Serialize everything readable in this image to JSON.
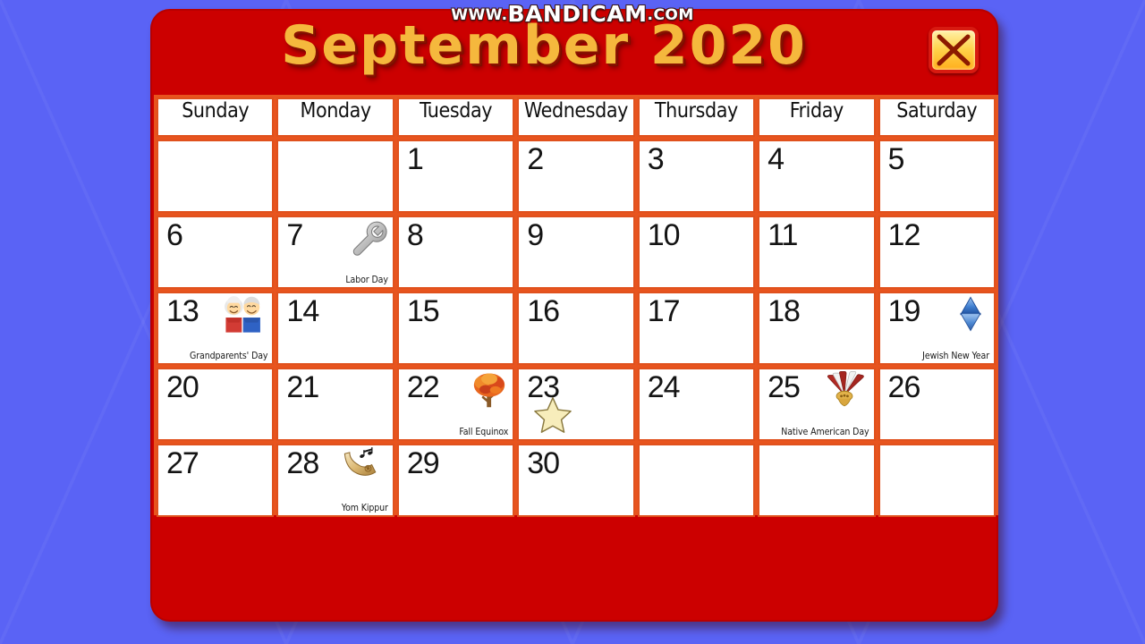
{
  "watermark": {
    "prefix": "WWW.",
    "brand": "BANDICAM",
    "suffix": ".COM"
  },
  "window": {
    "title": "September 2020",
    "close_label": "×",
    "close_icon": "close-x-icon",
    "panel_color": "#cc0000",
    "title_color": "#f5b83d",
    "grid_line_color": "#e8541e",
    "blank_cell_color": "#ff9300",
    "background_color": "#5a63f5"
  },
  "calendar": {
    "month": "September",
    "year": "2020",
    "weekdays": [
      "Sunday",
      "Monday",
      "Tuesday",
      "Wednesday",
      "Thursday",
      "Friday",
      "Saturday"
    ],
    "weeks": [
      [
        {
          "day": "",
          "blank": true
        },
        {
          "day": "",
          "blank": true
        },
        {
          "day": "1"
        },
        {
          "day": "2"
        },
        {
          "day": "3"
        },
        {
          "day": "4"
        },
        {
          "day": "5"
        }
      ],
      [
        {
          "day": "6"
        },
        {
          "day": "7",
          "holiday": "Labor Day",
          "icon": "wrench-icon"
        },
        {
          "day": "8"
        },
        {
          "day": "9"
        },
        {
          "day": "10"
        },
        {
          "day": "11"
        },
        {
          "day": "12"
        }
      ],
      [
        {
          "day": "13",
          "holiday": "Grandparents' Day",
          "icon": "elderly-couple-icon"
        },
        {
          "day": "14"
        },
        {
          "day": "15"
        },
        {
          "day": "16"
        },
        {
          "day": "17"
        },
        {
          "day": "18"
        },
        {
          "day": "19",
          "holiday": "Jewish New Year",
          "icon": "star-of-david-icon"
        }
      ],
      [
        {
          "day": "20"
        },
        {
          "day": "21"
        },
        {
          "day": "22",
          "holiday": "Fall Equinox",
          "icon": "autumn-tree-icon"
        },
        {
          "day": "23",
          "cursor": true
        },
        {
          "day": "24"
        },
        {
          "day": "25",
          "holiday": "Native American Day",
          "icon": "headdress-icon"
        },
        {
          "day": "26"
        }
      ],
      [
        {
          "day": "27"
        },
        {
          "day": "28",
          "holiday": "Yom Kippur",
          "icon": "shofar-icon"
        },
        {
          "day": "29"
        },
        {
          "day": "30"
        },
        {
          "day": "",
          "blank": true
        },
        {
          "day": "",
          "blank": true
        },
        {
          "day": "",
          "blank": true
        }
      ]
    ]
  },
  "cursor": {
    "icon": "star-cursor-icon",
    "fill": "#f7edbb",
    "stroke": "#8a7a40"
  }
}
